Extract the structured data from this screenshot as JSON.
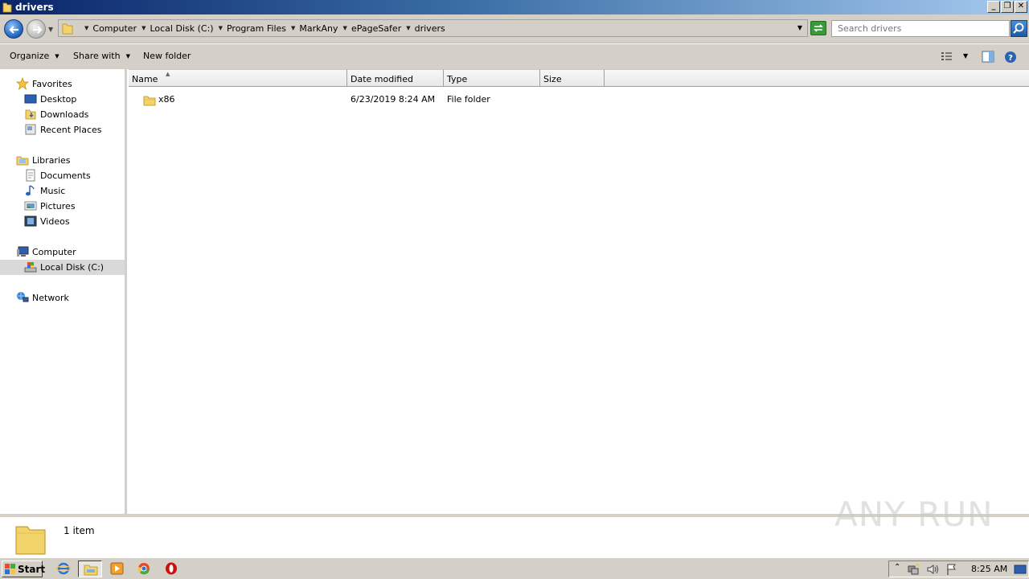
{
  "window": {
    "title": "drivers"
  },
  "address": {
    "crumbs": [
      "Computer",
      "Local Disk (C:)",
      "Program Files",
      "MarkAny",
      "ePageSafer",
      "drivers"
    ]
  },
  "search": {
    "placeholder": "Search drivers"
  },
  "toolbar": {
    "organize": "Organize",
    "share_with": "Share with",
    "new_folder": "New folder"
  },
  "nav": {
    "favorites": "Favorites",
    "desktop": "Desktop",
    "downloads": "Downloads",
    "recent_places": "Recent Places",
    "libraries": "Libraries",
    "documents": "Documents",
    "music": "Music",
    "pictures": "Pictures",
    "videos": "Videos",
    "computer": "Computer",
    "local_disk": "Local Disk (C:)",
    "network": "Network"
  },
  "columns": {
    "name": "Name",
    "date": "Date modified",
    "type": "Type",
    "size": "Size"
  },
  "files": [
    {
      "name": "x86",
      "date": "6/23/2019 8:24 AM",
      "type": "File folder",
      "size": ""
    }
  ],
  "details": {
    "count": "1 item"
  },
  "watermark": "ANY RUN",
  "taskbar": {
    "start": "Start",
    "clock": "8:25 AM"
  },
  "colors": {
    "title_start": "#0a246a",
    "title_end": "#a6caf0",
    "chrome": "#d4d0c8",
    "selection": "#d9d9d9"
  }
}
